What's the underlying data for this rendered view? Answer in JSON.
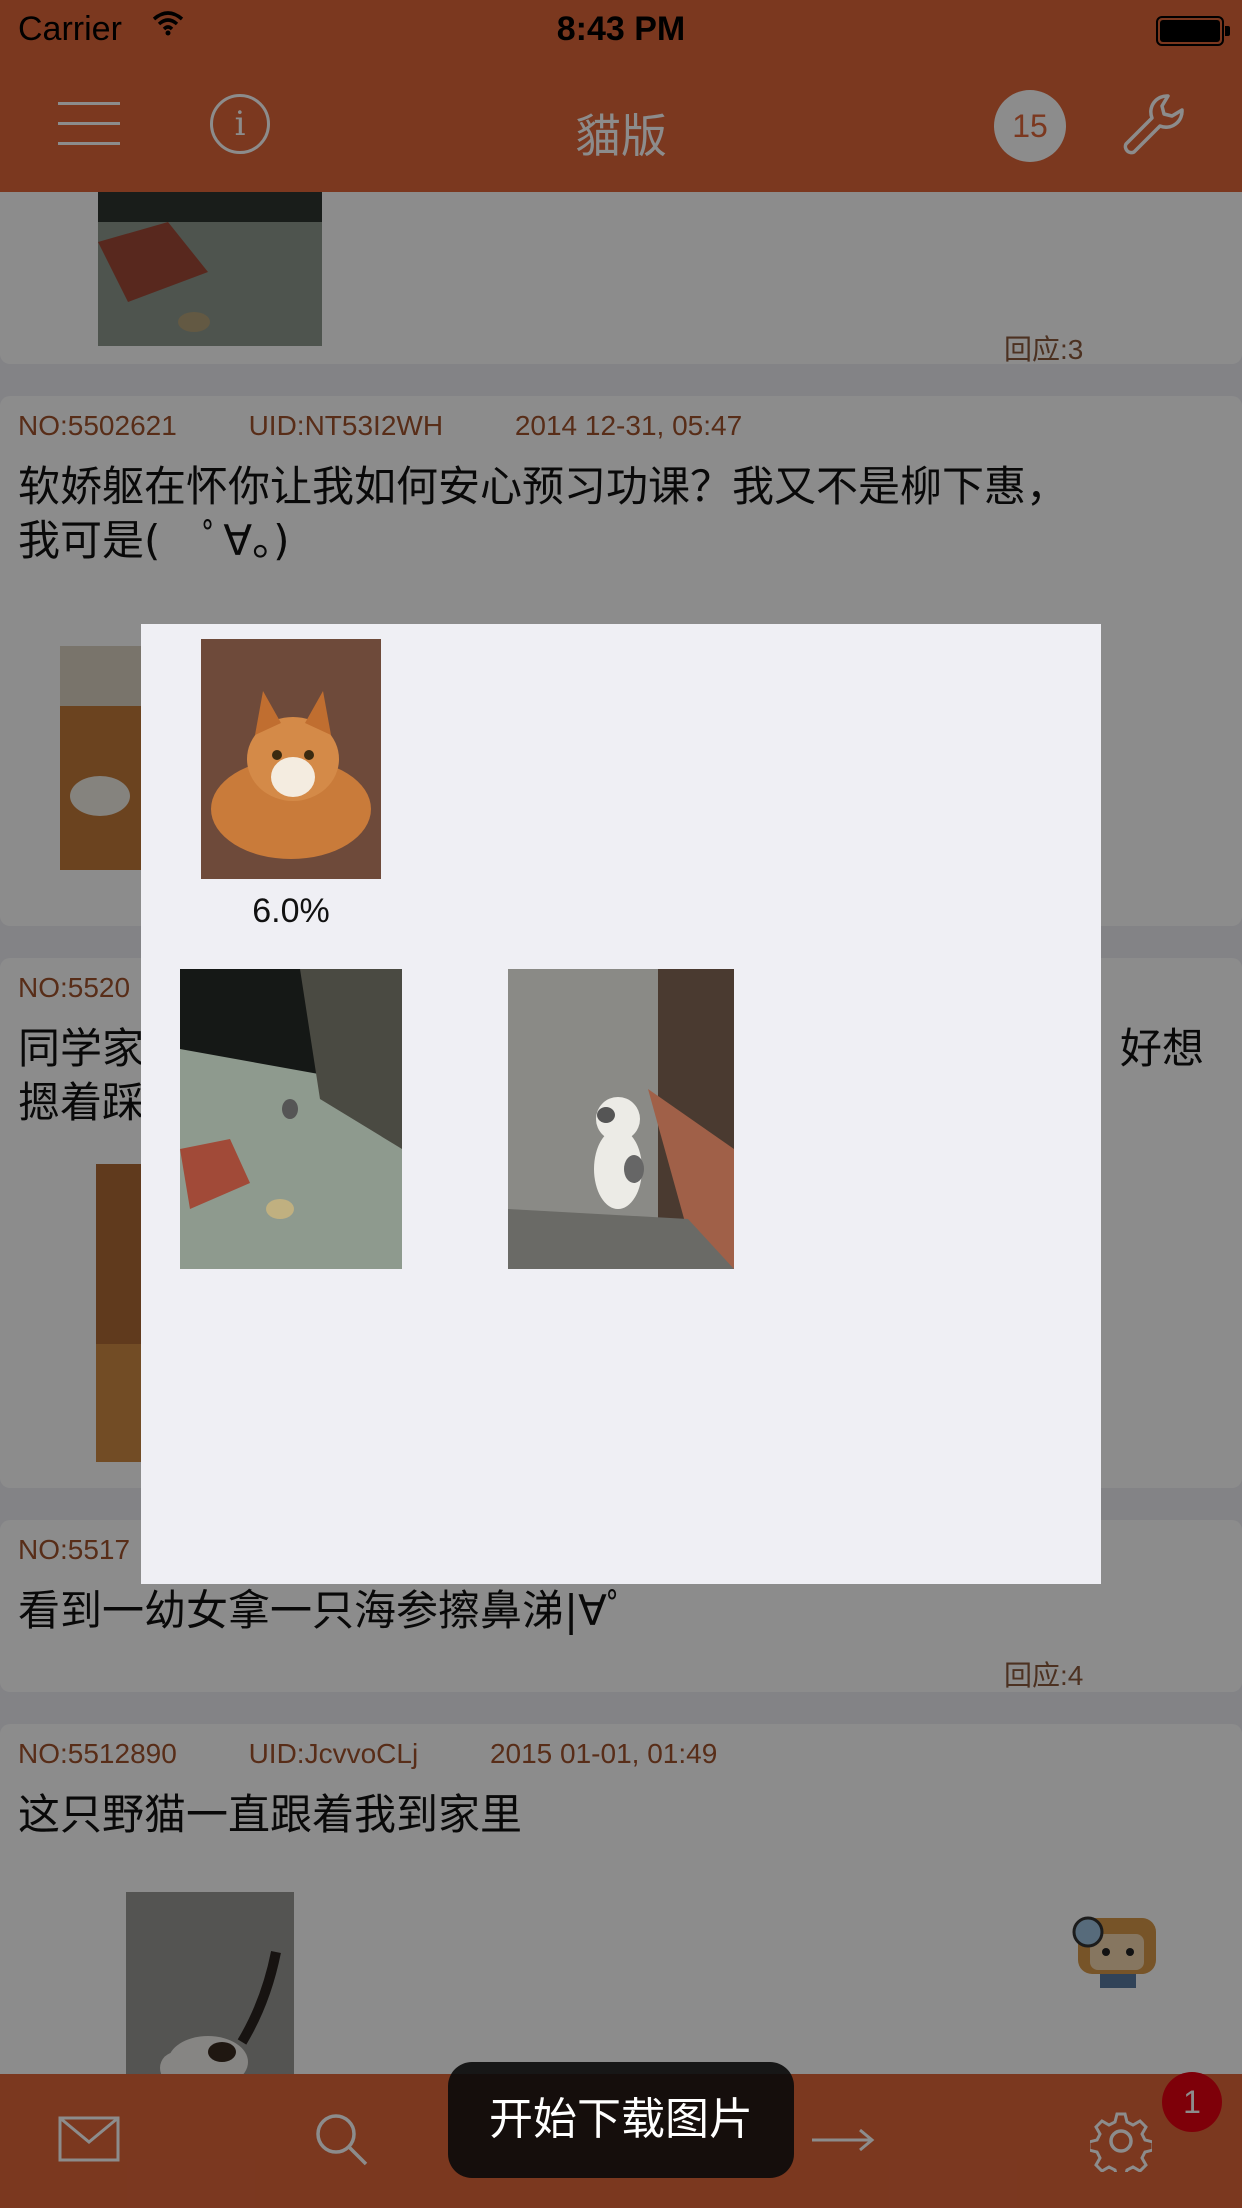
{
  "status_bar": {
    "carrier": "Carrier",
    "time": "8:43 PM"
  },
  "nav": {
    "title": "貓版",
    "badge_count": "15"
  },
  "posts": [
    {
      "reply": "回应:3"
    },
    {
      "no": "NO:5502621",
      "uid": "UID:NT53I2WH",
      "date": "2014 12-31, 05:47",
      "body": "软娇躯在怀你让我如何安心预习功课？我又不是柳下惠，\n我可是(　ﾟ∀。)"
    },
    {
      "no": "NO:5520",
      "body_left": "同学家\n摁着踩",
      "body_right": "好想"
    },
    {
      "no": "NO:5517",
      "body": "看到一幼女拿一只海参擦鼻涕|∀ﾟ",
      "reply": "回应:4"
    },
    {
      "no": "NO:5512890",
      "uid": "UID:JcvvoCLj",
      "date": "2015 01-01, 01:49",
      "body": "这只野猫一直跟着我到家里"
    }
  ],
  "download_dialog": {
    "progress": "6.0%"
  },
  "toast": "开始下载图片",
  "tabbar": {
    "notification_badge": "1"
  },
  "icons": [
    "menu-icon",
    "info-icon",
    "wrench-icon",
    "mail-icon",
    "search-icon",
    "arrow-right-icon",
    "gear-icon",
    "wifi-icon",
    "battery-icon"
  ],
  "colors": {
    "accent": "#e0663a",
    "meta_text": "#a0522d",
    "badge_red": "#e60012"
  }
}
